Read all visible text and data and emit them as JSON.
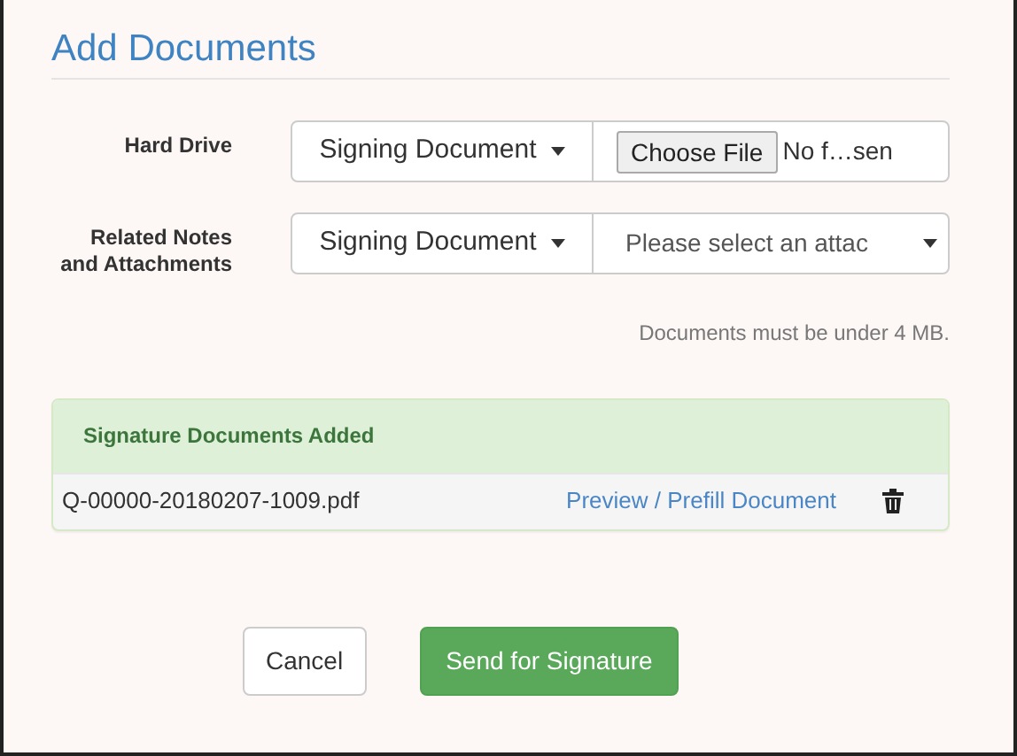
{
  "title": "Add Documents",
  "sources": [
    {
      "label": "Hard Drive",
      "type_button": "Signing Document",
      "kind": "file",
      "button": "Choose File",
      "file_name": "No f…sen"
    },
    {
      "label": "Related Notes and Attachments",
      "type_button": "Signing Document",
      "kind": "select",
      "select_text": "Please select an attac"
    }
  ],
  "note": "Documents must be under 4 MB.",
  "panel": {
    "title": "Signature Documents Added",
    "documents": [
      {
        "name": "Q-00000-20180207-1009.pdf",
        "link": "Preview / Prefill Document"
      }
    ]
  },
  "buttons": [
    {
      "label": "Cancel",
      "kind": "default"
    },
    {
      "label": "Send for Signature",
      "kind": "primary"
    }
  ]
}
